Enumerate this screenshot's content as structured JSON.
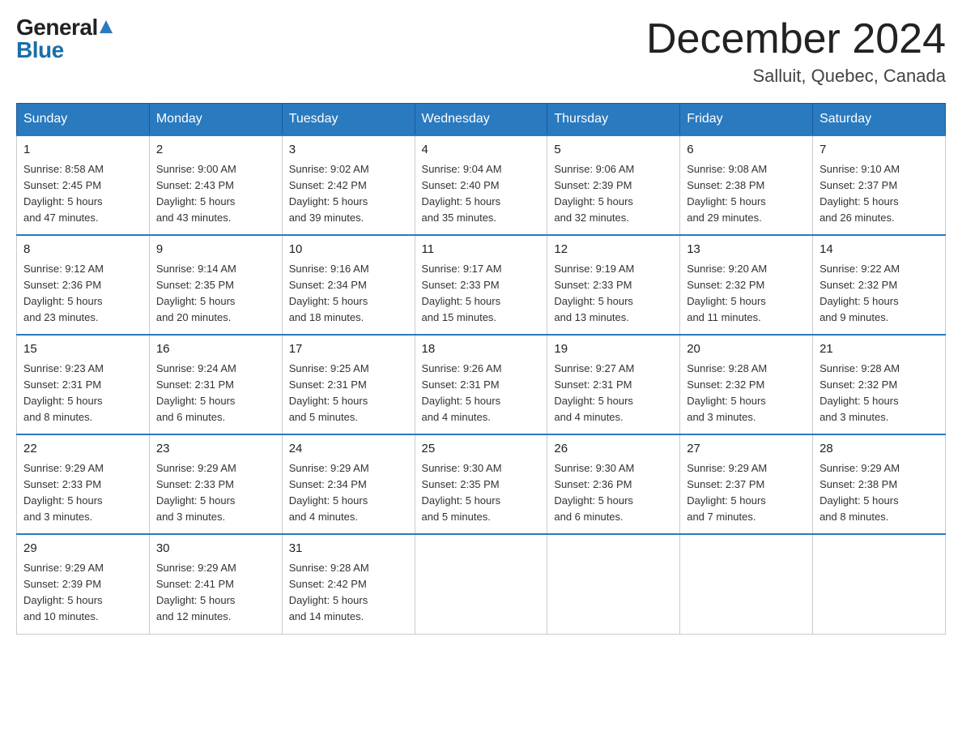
{
  "logo": {
    "general": "General",
    "blue": "Blue"
  },
  "title": {
    "month_year": "December 2024",
    "location": "Salluit, Quebec, Canada"
  },
  "weekdays": [
    "Sunday",
    "Monday",
    "Tuesday",
    "Wednesday",
    "Thursday",
    "Friday",
    "Saturday"
  ],
  "weeks": [
    [
      {
        "day": "1",
        "sunrise": "8:58 AM",
        "sunset": "2:45 PM",
        "daylight": "5 hours and 47 minutes."
      },
      {
        "day": "2",
        "sunrise": "9:00 AM",
        "sunset": "2:43 PM",
        "daylight": "5 hours and 43 minutes."
      },
      {
        "day": "3",
        "sunrise": "9:02 AM",
        "sunset": "2:42 PM",
        "daylight": "5 hours and 39 minutes."
      },
      {
        "day": "4",
        "sunrise": "9:04 AM",
        "sunset": "2:40 PM",
        "daylight": "5 hours and 35 minutes."
      },
      {
        "day": "5",
        "sunrise": "9:06 AM",
        "sunset": "2:39 PM",
        "daylight": "5 hours and 32 minutes."
      },
      {
        "day": "6",
        "sunrise": "9:08 AM",
        "sunset": "2:38 PM",
        "daylight": "5 hours and 29 minutes."
      },
      {
        "day": "7",
        "sunrise": "9:10 AM",
        "sunset": "2:37 PM",
        "daylight": "5 hours and 26 minutes."
      }
    ],
    [
      {
        "day": "8",
        "sunrise": "9:12 AM",
        "sunset": "2:36 PM",
        "daylight": "5 hours and 23 minutes."
      },
      {
        "day": "9",
        "sunrise": "9:14 AM",
        "sunset": "2:35 PM",
        "daylight": "5 hours and 20 minutes."
      },
      {
        "day": "10",
        "sunrise": "9:16 AM",
        "sunset": "2:34 PM",
        "daylight": "5 hours and 18 minutes."
      },
      {
        "day": "11",
        "sunrise": "9:17 AM",
        "sunset": "2:33 PM",
        "daylight": "5 hours and 15 minutes."
      },
      {
        "day": "12",
        "sunrise": "9:19 AM",
        "sunset": "2:33 PM",
        "daylight": "5 hours and 13 minutes."
      },
      {
        "day": "13",
        "sunrise": "9:20 AM",
        "sunset": "2:32 PM",
        "daylight": "5 hours and 11 minutes."
      },
      {
        "day": "14",
        "sunrise": "9:22 AM",
        "sunset": "2:32 PM",
        "daylight": "5 hours and 9 minutes."
      }
    ],
    [
      {
        "day": "15",
        "sunrise": "9:23 AM",
        "sunset": "2:31 PM",
        "daylight": "5 hours and 8 minutes."
      },
      {
        "day": "16",
        "sunrise": "9:24 AM",
        "sunset": "2:31 PM",
        "daylight": "5 hours and 6 minutes."
      },
      {
        "day": "17",
        "sunrise": "9:25 AM",
        "sunset": "2:31 PM",
        "daylight": "5 hours and 5 minutes."
      },
      {
        "day": "18",
        "sunrise": "9:26 AM",
        "sunset": "2:31 PM",
        "daylight": "5 hours and 4 minutes."
      },
      {
        "day": "19",
        "sunrise": "9:27 AM",
        "sunset": "2:31 PM",
        "daylight": "5 hours and 4 minutes."
      },
      {
        "day": "20",
        "sunrise": "9:28 AM",
        "sunset": "2:32 PM",
        "daylight": "5 hours and 3 minutes."
      },
      {
        "day": "21",
        "sunrise": "9:28 AM",
        "sunset": "2:32 PM",
        "daylight": "5 hours and 3 minutes."
      }
    ],
    [
      {
        "day": "22",
        "sunrise": "9:29 AM",
        "sunset": "2:33 PM",
        "daylight": "5 hours and 3 minutes."
      },
      {
        "day": "23",
        "sunrise": "9:29 AM",
        "sunset": "2:33 PM",
        "daylight": "5 hours and 3 minutes."
      },
      {
        "day": "24",
        "sunrise": "9:29 AM",
        "sunset": "2:34 PM",
        "daylight": "5 hours and 4 minutes."
      },
      {
        "day": "25",
        "sunrise": "9:30 AM",
        "sunset": "2:35 PM",
        "daylight": "5 hours and 5 minutes."
      },
      {
        "day": "26",
        "sunrise": "9:30 AM",
        "sunset": "2:36 PM",
        "daylight": "5 hours and 6 minutes."
      },
      {
        "day": "27",
        "sunrise": "9:29 AM",
        "sunset": "2:37 PM",
        "daylight": "5 hours and 7 minutes."
      },
      {
        "day": "28",
        "sunrise": "9:29 AM",
        "sunset": "2:38 PM",
        "daylight": "5 hours and 8 minutes."
      }
    ],
    [
      {
        "day": "29",
        "sunrise": "9:29 AM",
        "sunset": "2:39 PM",
        "daylight": "5 hours and 10 minutes."
      },
      {
        "day": "30",
        "sunrise": "9:29 AM",
        "sunset": "2:41 PM",
        "daylight": "5 hours and 12 minutes."
      },
      {
        "day": "31",
        "sunrise": "9:28 AM",
        "sunset": "2:42 PM",
        "daylight": "5 hours and 14 minutes."
      },
      null,
      null,
      null,
      null
    ]
  ],
  "labels": {
    "sunrise_prefix": "Sunrise: ",
    "sunset_prefix": "Sunset: ",
    "daylight_prefix": "Daylight: "
  }
}
